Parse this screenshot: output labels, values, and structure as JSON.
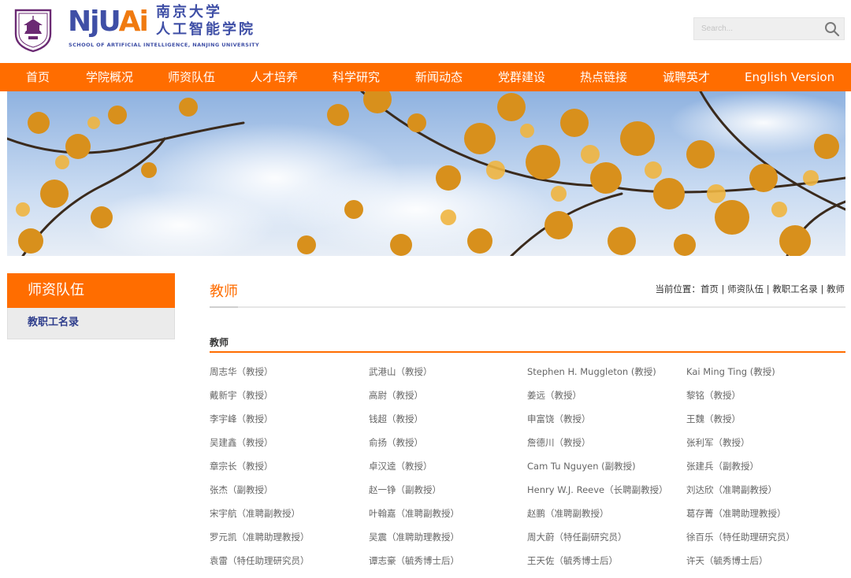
{
  "header": {
    "logo_nju": "NjU",
    "logo_ai": "Ai",
    "school_cn_line1": "南京大学",
    "school_cn_line2": "人工智能学院",
    "school_en": "School of Artificial Intelligence, Nanjing University",
    "search": {
      "placeholder": "Search..."
    }
  },
  "nav": {
    "items": [
      {
        "label": "首页"
      },
      {
        "label": "学院概况"
      },
      {
        "label": "师资队伍"
      },
      {
        "label": "人才培养"
      },
      {
        "label": "科学研究"
      },
      {
        "label": "新闻动态"
      },
      {
        "label": "党群建设"
      },
      {
        "label": "热点链接"
      },
      {
        "label": "诚聘英才"
      },
      {
        "label": "English Version"
      }
    ]
  },
  "sidebar": {
    "title": "师资队伍",
    "items": [
      {
        "label": "教职工名录"
      }
    ]
  },
  "main": {
    "title": "教师",
    "breadcrumb": {
      "prefix": "当前位置：",
      "items": [
        "首页",
        "师资队伍",
        "教职工名录",
        "教师"
      ],
      "separator": " | "
    },
    "section_title": "教师",
    "faculty_rows": [
      [
        "周志华（教授）",
        "武港山（教授）",
        "Stephen H. Muggleton (教授)",
        "Kai Ming Ting (教授)"
      ],
      [
        "戴新宇（教授）",
        "高尉（教授）",
        "姜远（教授）",
        "黎铭（教授）"
      ],
      [
        "李宇峰（教授）",
        "钱超（教授）",
        "申富饶（教授）",
        "王魏（教授）"
      ],
      [
        "吴建鑫（教授）",
        "俞扬（教授）",
        "詹德川（教授）",
        "张利军（教授）"
      ],
      [
        "章宗长（教授）",
        "卓汉逵（教授）",
        "Cam Tu Nguyen (副教授)",
        "张建兵（副教授）"
      ],
      [
        "张杰（副教授）",
        "赵一铮（副教授）",
        "Henry W.J. Reeve（长聘副教授）",
        "刘达欣（准聘副教授）"
      ],
      [
        "宋宇航（准聘副教授）",
        "叶翰嘉（准聘副教授）",
        "赵鹏（准聘副教授）",
        "葛存菁（准聘助理教授）"
      ],
      [
        "罗元凯（准聘助理教授）",
        "吴震（准聘助理教授）",
        "周大蔚（特任副研究员）",
        "徐百乐（特任助理研究员）"
      ],
      [
        "袁雷（特任助理研究员）",
        "谭志豪（毓秀博士后）",
        "王天佐（毓秀博士后）",
        "许天（毓秀博士后）"
      ]
    ]
  },
  "colors": {
    "brand_orange": "#ff6d00",
    "brand_blue": "#3f4fa6",
    "seal_purple": "#6b2a73"
  },
  "icons": {
    "seal": "nju-seal-icon",
    "search": "search-icon"
  }
}
